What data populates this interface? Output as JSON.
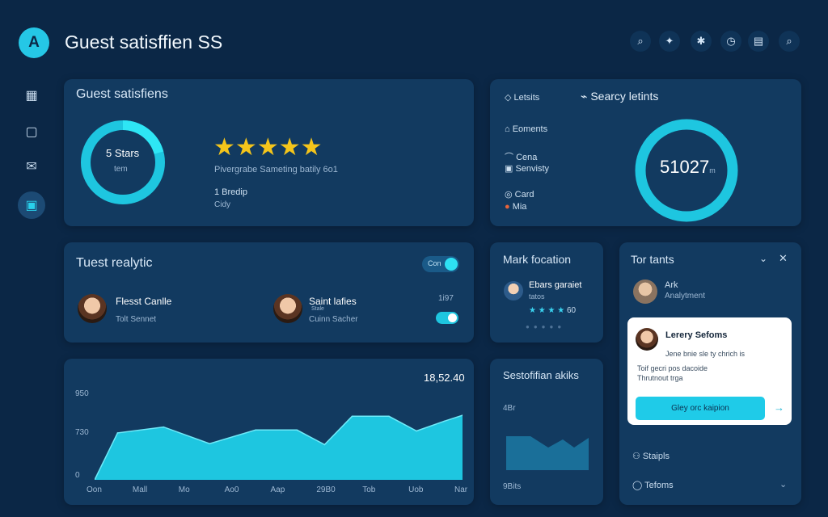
{
  "header": {
    "logo_letter": "A",
    "title": "Guest satisffien SS"
  },
  "toolbar": {
    "icons": [
      "search-icon",
      "twitter-icon",
      "settings-icon",
      "clock-icon",
      "message-icon",
      "search-icon"
    ]
  },
  "sidebar": {
    "items": [
      "building-icon",
      "document-icon",
      "mail-icon",
      "grid-icon"
    ]
  },
  "satisfaction": {
    "title": "Guest satisfiens",
    "ring_main": "5 Stars",
    "ring_sub": "tem",
    "rating_stars": 5,
    "description": "Pivergrabe Sameting batily 6o1",
    "detail_1": "1 Bredip",
    "detail_2": "Cidy"
  },
  "search_panel": {
    "tab_1": "Letsits",
    "tab_2": "Searcy letints",
    "items": [
      {
        "label": "Eoments"
      },
      {
        "label": "Cena"
      },
      {
        "label": "Senvisty"
      },
      {
        "label": "Card"
      },
      {
        "label": "Mia"
      }
    ],
    "ring_value": "51027",
    "ring_unit": "m"
  },
  "analytics": {
    "title": "Tuest realytic",
    "toggle_label": "Con",
    "toggle_on": true,
    "guests": [
      {
        "name": "Flesst Canlle",
        "sub": "Tolt Sennet"
      },
      {
        "name": "Saint lafies",
        "badge": "Stale",
        "sub": "Cuinn Sacher",
        "count": "1i97"
      }
    ]
  },
  "mark_location": {
    "title": "Mark focation",
    "name": "Ebars garaiet",
    "sub": "tatos",
    "rating_value": "60",
    "stars": 4,
    "dots": 5
  },
  "tor_tants": {
    "title": "Tor tants",
    "user_name": "Ark",
    "user_role": "Analytment",
    "popup": {
      "name": "Lerery Sefoms",
      "line_1": "Jene bnie sle ty chrich is",
      "line_2": "Toif gecri pos dacoide",
      "line_3": "Thrutnout trga",
      "button": "Gley orc kaipion"
    },
    "footer_1": "Staipls",
    "footer_2": "Tefoms"
  },
  "stats": {
    "title": "Sestofifian akiks",
    "label_top": "4Br",
    "label_bottom": "9Bits"
  },
  "chart_data": {
    "type": "area",
    "title": "",
    "peak_label": "18,52.40",
    "x_ticks": [
      "Oon",
      "Mall",
      "Mo",
      "Ao0",
      "Aap",
      "29B0",
      "Tob",
      "Uob",
      "Nar"
    ],
    "y_ticks": [
      "950",
      "730",
      "0"
    ],
    "x": [
      0,
      0.5,
      1.5,
      2.5,
      3.5,
      4.4,
      5,
      5.6,
      6.4,
      7,
      7.6,
      8,
      8.6,
      9
    ],
    "y": [
      0,
      480,
      540,
      370,
      510,
      510,
      360,
      650,
      650,
      500,
      600,
      660,
      700,
      750
    ],
    "ylim": [
      0,
      950
    ],
    "color": "#1ec6e0"
  },
  "colors": {
    "bg": "#0b2746",
    "card": "#123a60",
    "accent": "#1ec6e0",
    "star": "#f4c51b"
  }
}
